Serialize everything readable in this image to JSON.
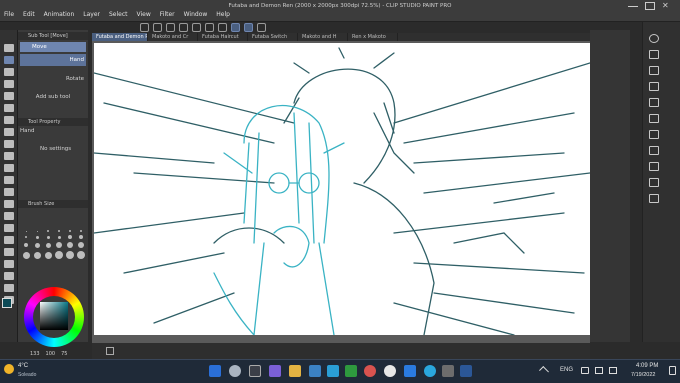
{
  "window": {
    "title": "Futaba and Demon Ren (2000 x 2000px 300dpi 72.5%) - CLIP STUDIO PAINT PRO"
  },
  "menu": [
    "File",
    "Edit",
    "Animation",
    "Layer",
    "Select",
    "View",
    "Filter",
    "Window",
    "Help"
  ],
  "subtool_panel": {
    "header": "Sub Tool [Move]",
    "items": [
      "Move",
      "Hand",
      "Rotate"
    ],
    "add_label": "Add sub tool"
  },
  "tool_property": {
    "header": "Tool Property",
    "tool_name": "Hand",
    "body": "No settings"
  },
  "brush_size": {
    "header": "Brush Size"
  },
  "color_readout": {
    "r": "133",
    "g": "100",
    "b": "75"
  },
  "tabs": [
    "Futaba and Demon Ren",
    "Makoto and Cr",
    "Futaba Haircut",
    "Futaba Switch",
    "Makoto and H",
    "Ren x Makoto"
  ],
  "taskbar": {
    "weather_temp": "4°C",
    "weather_desc": "Soleado",
    "lang": "ENG",
    "time": "4:09 PM",
    "date": "7/19/2022"
  },
  "colors": {
    "sketch_dark": "#2f5f66",
    "sketch_light": "#3ab3c4",
    "accent": "#4a5f80"
  }
}
